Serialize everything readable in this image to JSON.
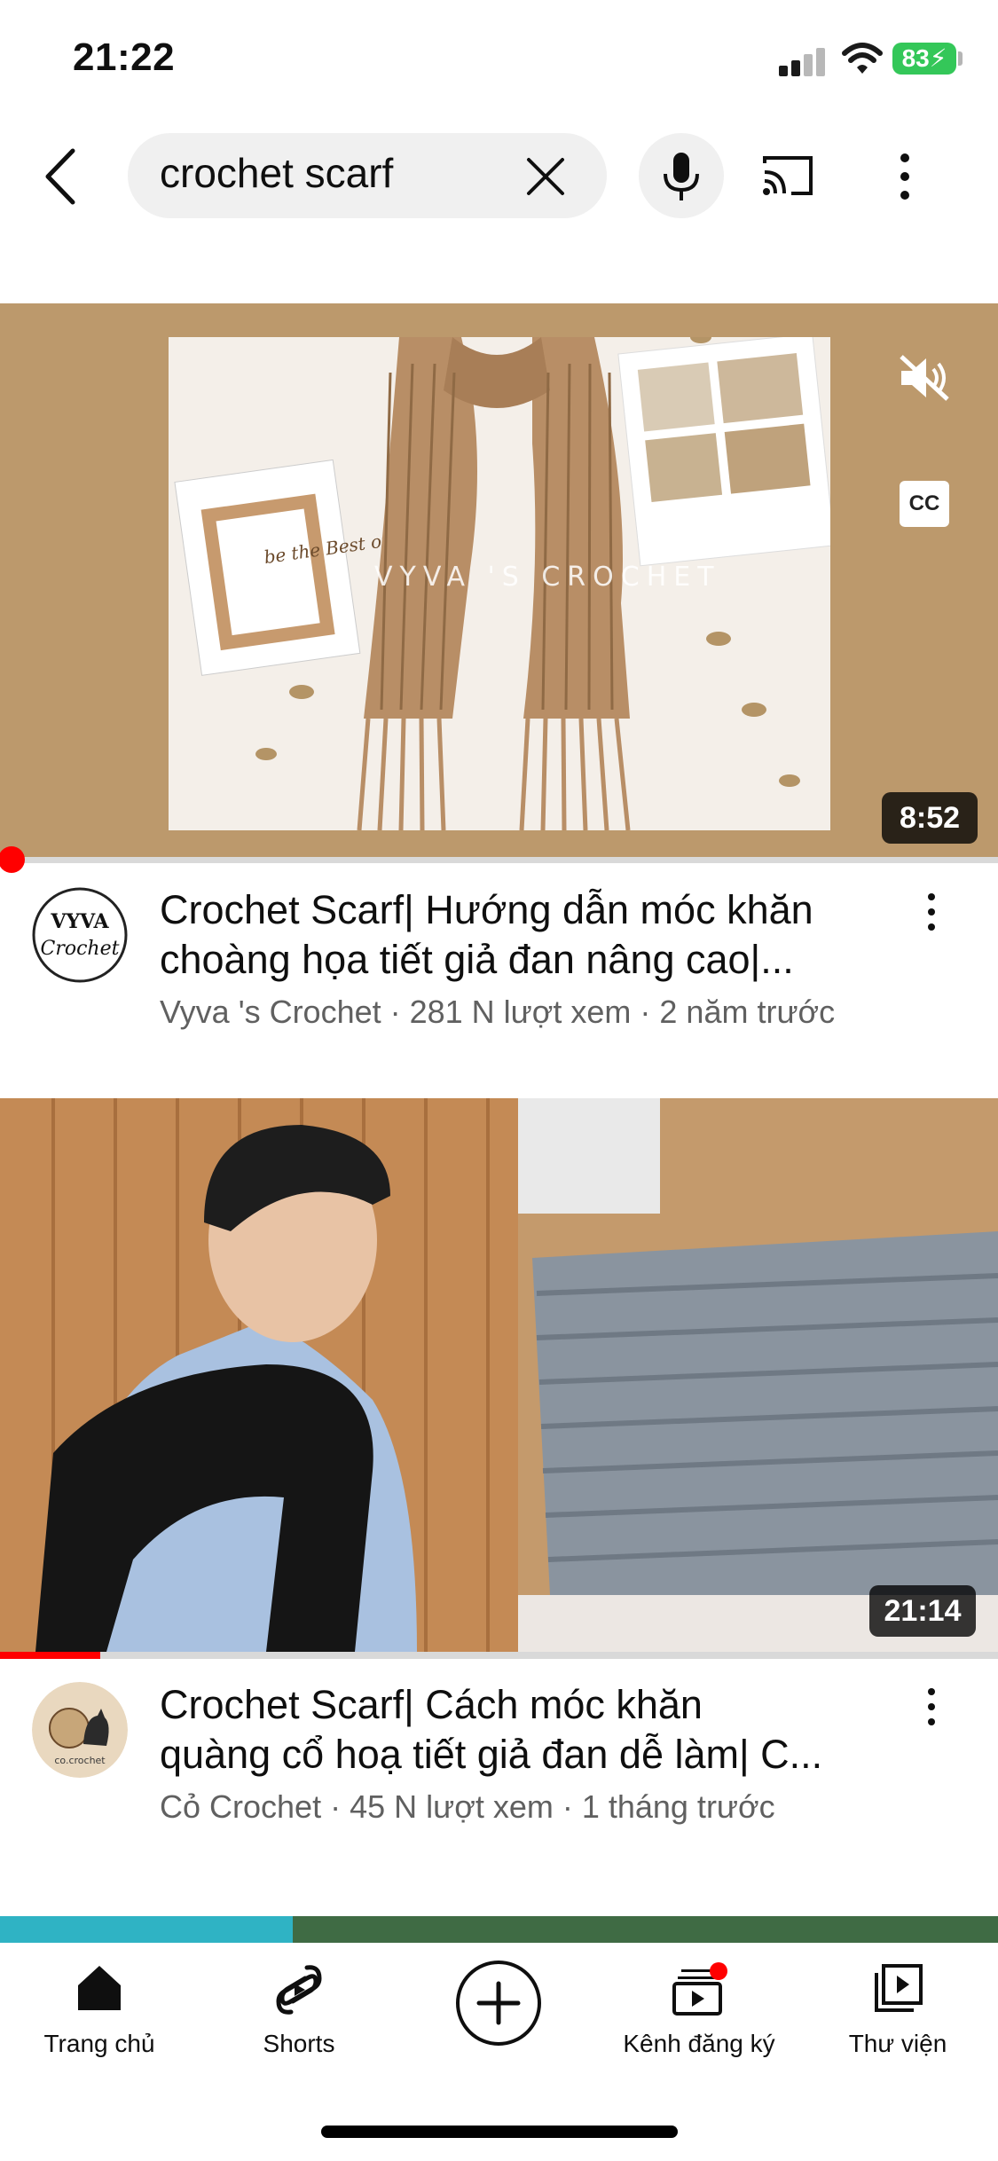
{
  "status_bar": {
    "time": "21:22",
    "battery": "83"
  },
  "search": {
    "query": "crochet scarf"
  },
  "videos": [
    {
      "duration": "8:52",
      "watermark": "VYVA 'S CROCHET",
      "title_line1": "Crochet Scarf| Hướng dẫn móc khăn",
      "title_line2": "choàng họa tiết giả đan nâng cao|...",
      "meta": "Vyva 's Crochet · 281 N lượt xem · 2 năm trước",
      "avatar_text": "VYVA Crochet",
      "notepad_text": "be the Best of you"
    },
    {
      "duration": "21:14",
      "title_line1": "Crochet Scarf| Cách móc khăn",
      "title_line2": "quàng cổ hoạ tiết giả đan dễ làm| C...",
      "meta": "Cỏ Crochet · 45 N lượt xem · 1 tháng trước",
      "avatar_text": "co.crochet",
      "progress": 0.1
    }
  ],
  "nav": {
    "home": "Trang chủ",
    "shorts": "Shorts",
    "subscriptions": "Kênh đăng ký",
    "library": "Thư viện"
  },
  "colors": {
    "accent": "#ff0000",
    "video1_bg": "#bc996c",
    "battery": "#34c759"
  }
}
